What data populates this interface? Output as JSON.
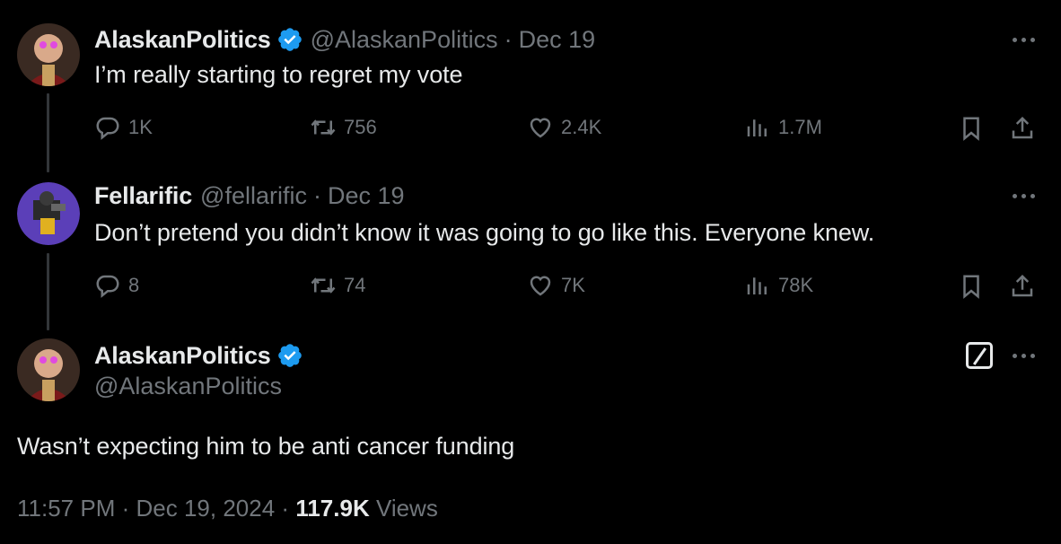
{
  "tweets": [
    {
      "name": "AlaskanPolitics",
      "handle": "@AlaskanPolitics",
      "separator": "·",
      "date": "Dec 19",
      "text": "I’m really starting to regret my vote",
      "replies": "1K",
      "reposts": "756",
      "likes": "2.4K",
      "views": "1.7M"
    },
    {
      "name": "Fellarific",
      "handle": "@fellarific",
      "separator": "·",
      "date": "Dec 19",
      "text": "Don’t pretend you didn’t know it was going to go like this. Everyone knew.",
      "replies": "8",
      "reposts": "74",
      "likes": "7K",
      "views": "78K"
    }
  ],
  "main": {
    "name": "AlaskanPolitics",
    "handle": "@AlaskanPolitics",
    "text": "Wasn’t expecting him to be anti cancer funding",
    "time": "11:57 PM",
    "separator": "·",
    "date": "Dec 19, 2024",
    "views_count": "117.9K",
    "views_label": "Views"
  },
  "colors": {
    "background": "#000000",
    "text": "#e7e9ea",
    "muted": "#71767b",
    "verified": "#1d9bf0"
  }
}
